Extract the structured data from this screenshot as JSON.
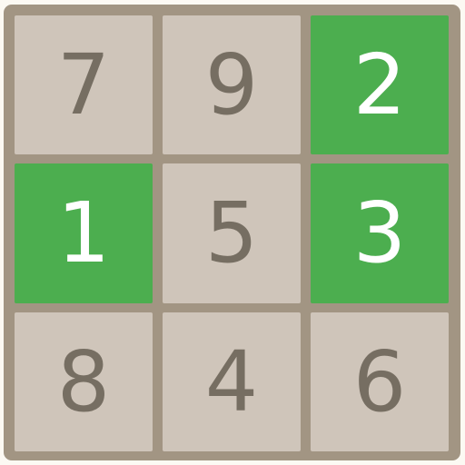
{
  "board": {
    "tiles": [
      {
        "value": "7",
        "highlighted": false
      },
      {
        "value": "9",
        "highlighted": false
      },
      {
        "value": "2",
        "highlighted": true
      },
      {
        "value": "1",
        "highlighted": true
      },
      {
        "value": "5",
        "highlighted": false
      },
      {
        "value": "3",
        "highlighted": true
      },
      {
        "value": "8",
        "highlighted": false
      },
      {
        "value": "4",
        "highlighted": false
      },
      {
        "value": "6",
        "highlighted": false
      }
    ]
  },
  "colors": {
    "page_background": "#fcf9f3",
    "board_frame": "#a29583",
    "tile_default": "#cfc5ba",
    "tile_highlight": "#4cae4f",
    "digit_default": "#766e62",
    "digit_highlight": "#ffffff"
  }
}
